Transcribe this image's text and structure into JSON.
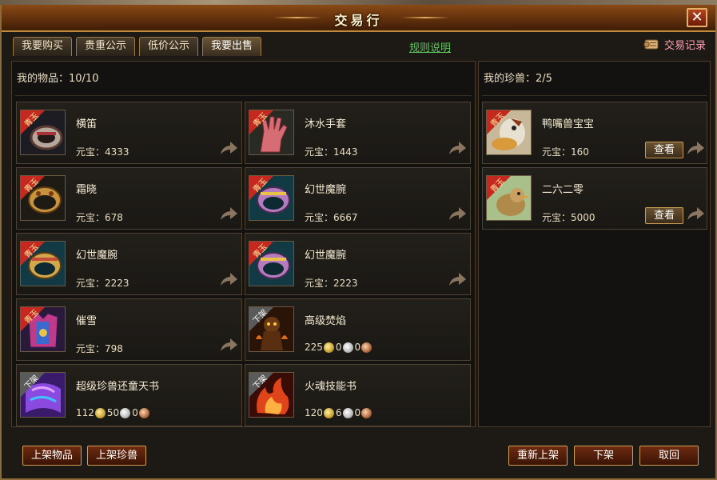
{
  "window": {
    "title": "交易行",
    "close_glyph": "✕"
  },
  "tabs": [
    {
      "label": "我要购买"
    },
    {
      "label": "贵重公示"
    },
    {
      "label": "低价公示"
    },
    {
      "label": "我要出售"
    }
  ],
  "rules_link": "规则说明",
  "trade_record": "交易记录",
  "my_items": {
    "header": "我的物品：10/10",
    "price_prefix": "元宝：",
    "items": [
      {
        "name": "横笛",
        "price": "4333",
        "badge": "青玉",
        "icon": "ring-icon"
      },
      {
        "name": "沐水手套",
        "price": "1443",
        "badge": "青玉",
        "icon": "glove-icon"
      },
      {
        "name": "霜晓",
        "price": "678",
        "badge": "青玉",
        "icon": "bracelet-icon"
      },
      {
        "name": "幻世魔腕",
        "price": "6667",
        "badge": "青玉",
        "icon": "bracelet-icon"
      },
      {
        "name": "幻世魔腕",
        "price": "2223",
        "badge": "青玉",
        "icon": "bracelet-icon"
      },
      {
        "name": "幻世魔腕",
        "price": "2223",
        "badge": "青玉",
        "icon": "bracelet-icon"
      },
      {
        "name": "催雪",
        "price": "798",
        "badge": "青玉",
        "icon": "armor-icon"
      },
      {
        "name": "高级焚焰",
        "badge": "下架",
        "coins": {
          "gold": "225",
          "silver": "0",
          "copper": "0"
        },
        "icon": "flame-demon-icon"
      },
      {
        "name": "超级珍兽还童天书",
        "badge": "下架",
        "coins": {
          "gold": "112",
          "silver": "50",
          "copper": "0"
        },
        "icon": "book-icon"
      },
      {
        "name": "火魂技能书",
        "badge": "下架",
        "coins": {
          "gold": "120",
          "silver": "6",
          "copper": "0"
        },
        "icon": "fire-book-icon"
      }
    ]
  },
  "my_pets": {
    "header": "我的珍兽：2/5",
    "price_prefix": "元宝：",
    "view_label": "查看",
    "pets": [
      {
        "name": "鸭嘴兽宝宝",
        "price": "160",
        "badge": "青玉",
        "icon": "duck-pet-icon"
      },
      {
        "name": "二六二零",
        "price": "5000",
        "badge": "青玉",
        "icon": "bird-pet-icon"
      }
    ]
  },
  "buttons": {
    "list_item": "上架物品",
    "list_pet": "上架珍兽",
    "relist": "重新上架",
    "delist": "下架",
    "cancel": "取回"
  },
  "colors": {
    "accent": "#c08a3a",
    "badge_red": "#c4281e",
    "badge_gray": "#5a5a5a",
    "link_green": "#5ec55e",
    "record_pink": "#ff9fb0"
  }
}
